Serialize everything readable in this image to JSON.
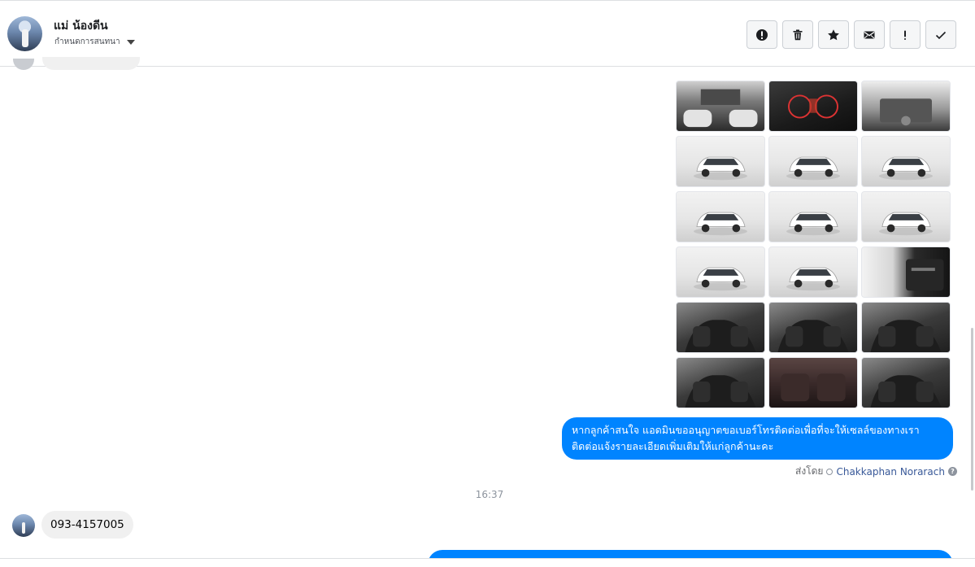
{
  "header": {
    "contact_name": "แม่ น้องดีน",
    "conversation_label": "กำหนดการสนทนา",
    "toolbar": [
      {
        "id": "spam",
        "icon": "alert-circle-icon"
      },
      {
        "id": "delete",
        "icon": "trash-icon"
      },
      {
        "id": "star",
        "icon": "star-icon"
      },
      {
        "id": "mark-unread",
        "icon": "envelope-icon"
      },
      {
        "id": "important",
        "icon": "exclamation-icon"
      },
      {
        "id": "done",
        "icon": "checkmark-icon"
      }
    ]
  },
  "photos": [
    {
      "kind": "cabin",
      "subject": "cargo-area"
    },
    {
      "kind": "dark",
      "subject": "gauge-cluster"
    },
    {
      "kind": "engine",
      "subject": "engine-bay"
    },
    {
      "kind": "studio",
      "subject": "car-front-left"
    },
    {
      "kind": "studio",
      "subject": "car-front"
    },
    {
      "kind": "studio",
      "subject": "car-front-right"
    },
    {
      "kind": "studio",
      "subject": "car-rear-left"
    },
    {
      "kind": "studio",
      "subject": "car-rear"
    },
    {
      "kind": "studio",
      "subject": "car-rear-right"
    },
    {
      "kind": "studio",
      "subject": "car-side"
    },
    {
      "kind": "studio",
      "subject": "wheel-closeup"
    },
    {
      "kind": "door",
      "subject": "door-panel"
    },
    {
      "kind": "interior",
      "subject": "dashboard"
    },
    {
      "kind": "interior",
      "subject": "gear-shift"
    },
    {
      "kind": "interior",
      "subject": "front-seats"
    },
    {
      "kind": "interior",
      "subject": "second-row-seats"
    },
    {
      "kind": "rear",
      "subject": "third-row-seats"
    },
    {
      "kind": "interior",
      "subject": "cabin-overview"
    }
  ],
  "outgoing_message": {
    "line1": "หากลูกค้าสนใจ แอดมินขออนุญาตขอเบอร์โทรติดต่อเพื่อที่จะให้เซลล์ของทางเรา",
    "line2": "ติดต่อแจ้งรายละเอียดเพิ่มเติมให้แก่ลูกค้านะคะ"
  },
  "sent_by": {
    "prefix": "ส่งโดย",
    "sender": "Chakkaphan Norarach",
    "help": "?"
  },
  "timestamp": "16:37",
  "incoming_message": "093-4157005",
  "colors": {
    "messenger_blue": "#0084ff",
    "incoming_gray": "#f0f0f0",
    "link": "#385898"
  }
}
